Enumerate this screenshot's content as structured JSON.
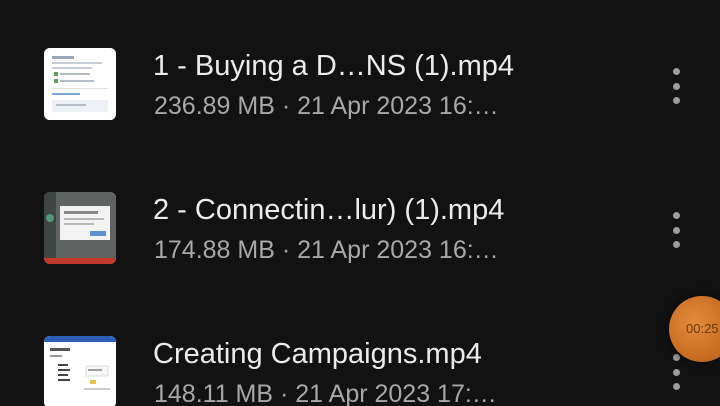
{
  "files": [
    {
      "title": "1 - Buying a D…NS (1).mp4",
      "meta": "236.89 MB · 21 Apr 2023 16:…",
      "thumbnail": "document-screenshot-thumbnail"
    },
    {
      "title": "2 - Connectin…lur) (1).mp4",
      "meta": "174.88 MB · 21 Apr 2023 16:…",
      "thumbnail": "dialog-screenshot-thumbnail"
    },
    {
      "title": "Creating Campaigns.mp4",
      "meta": "148.11 MB · 21 Apr 2023 17:…",
      "thumbnail": "webpage-screenshot-thumbnail"
    }
  ],
  "more_icon": "more-vertical-icon",
  "recording_timer": "00:25",
  "colors": {
    "background": "#121212",
    "title": "#ececec",
    "meta": "#a8a8a8",
    "timer": "#d27a2c"
  }
}
